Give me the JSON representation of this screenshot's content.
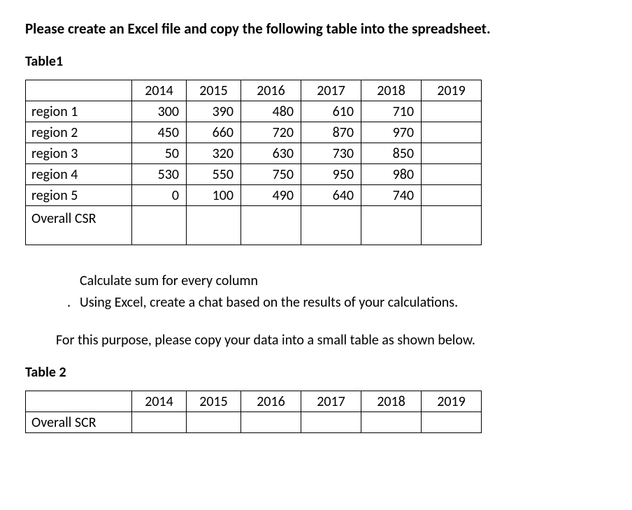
{
  "instruction": "Please create an Excel file and copy the following table into the spreadsheet.",
  "table1": {
    "label": "Table1",
    "years": [
      "2014",
      "2015",
      "2016",
      "2017",
      "2018",
      "2019"
    ],
    "rows": [
      {
        "label": "region 1",
        "values": [
          "300",
          "390",
          "480",
          "610",
          "710",
          ""
        ]
      },
      {
        "label": "region 2",
        "values": [
          "450",
          "660",
          "720",
          "870",
          "970",
          ""
        ]
      },
      {
        "label": "region 3",
        "values": [
          "50",
          "320",
          "630",
          "730",
          "850",
          ""
        ]
      },
      {
        "label": "region 4",
        "values": [
          "530",
          "550",
          "750",
          "950",
          "980",
          ""
        ]
      },
      {
        "label": "region 5",
        "values": [
          "0",
          "100",
          "490",
          "640",
          "740",
          ""
        ]
      }
    ],
    "overall_label": "Overall CSR"
  },
  "mid": {
    "line1": "Calculate sum for every column",
    "line2": "Using Excel, create a chat based on the results of your calculations.",
    "copy": "For this purpose, please copy your data into a small table as shown below."
  },
  "table2": {
    "label": "Table 2",
    "years": [
      "2014",
      "2015",
      "2016",
      "2017",
      "2018",
      "2019"
    ],
    "overall_label": "Overall SCR"
  }
}
